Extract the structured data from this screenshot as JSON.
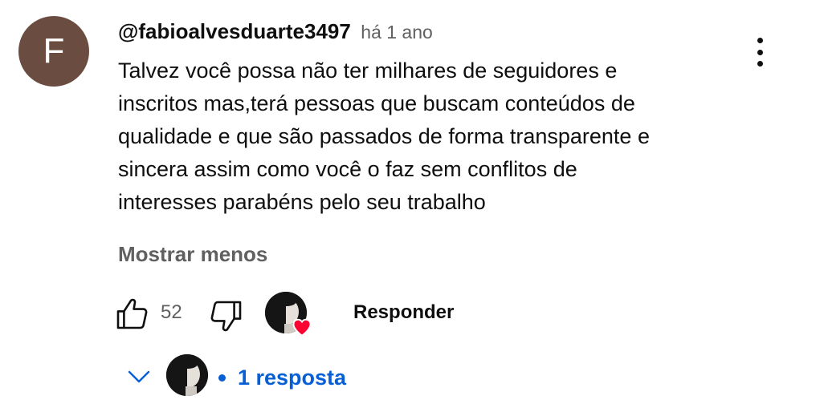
{
  "comment": {
    "avatar_letter": "F",
    "avatar_color": "#6b4c40",
    "author": "@fabioalvesduarte3497",
    "time": "há 1 ano",
    "text_lines": [
      "Talvez você possa não ter milhares de seguidores e",
      "inscritos mas,terá pessoas que buscam conteúdos de",
      "qualidade e que são passados de forma transparente e",
      "sincera assim como você o faz sem conflitos de",
      "interesses parabéns pelo seu trabalho"
    ],
    "show_less_label": "Mostrar menos",
    "menu_icon": "more-vert-icon"
  },
  "actions": {
    "like_icon": "thumb-up-icon",
    "like_count": "52",
    "dislike_icon": "thumb-down-icon",
    "creator_heart_icon": "heart-icon",
    "heart_color": "#ff0033",
    "reply_label": "Responder"
  },
  "replies": {
    "chevron_icon": "chevron-down-icon",
    "count_label": "1 resposta",
    "link_color": "#065fd4"
  }
}
